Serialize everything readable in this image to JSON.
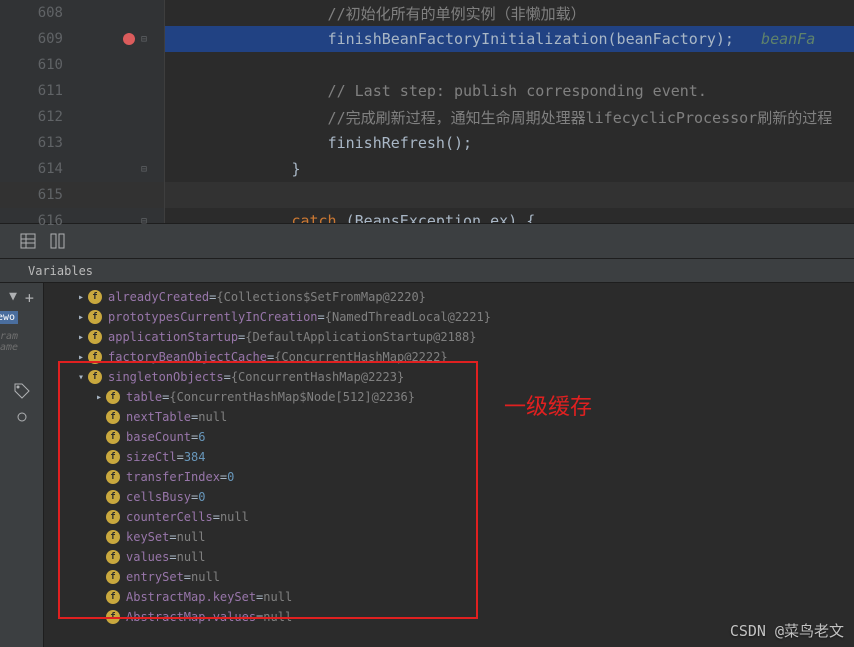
{
  "editor": {
    "lines": [
      {
        "num": "608",
        "kind": "cmt",
        "indent": "                  ",
        "text": "//初始化所有的单例实例（非懒加载）"
      },
      {
        "num": "609",
        "kind": "call",
        "indent": "                  ",
        "text": "finishBeanFactoryInitialization(beanFactory);",
        "hint": "   beanFa"
      },
      {
        "num": "610",
        "kind": "blank",
        "indent": "",
        "text": ""
      },
      {
        "num": "611",
        "kind": "cmt",
        "indent": "                  ",
        "text": "// Last step: publish corresponding event."
      },
      {
        "num": "612",
        "kind": "cmt",
        "indent": "                  ",
        "text": "//完成刷新过程，通知生命周期处理器lifecyclicProcessor刷新的过程"
      },
      {
        "num": "613",
        "kind": "call2",
        "indent": "                  ",
        "text": "finishRefresh();"
      },
      {
        "num": "614",
        "kind": "brace",
        "indent": "              ",
        "text": "}"
      },
      {
        "num": "615",
        "kind": "cursor",
        "indent": "",
        "text": ""
      },
      {
        "num": "616",
        "kind": "catch",
        "indent": "              ",
        "kw": "catch",
        "rest": " (BeansException ex) {"
      }
    ]
  },
  "variables_label": "Variables",
  "sidebar": {
    "sel_text": "ewo",
    "dim1": "ram",
    "dim2": "ame"
  },
  "tree": {
    "top": [
      {
        "name": "alreadyCreated",
        "val": "{Collections$SetFromMap@2220}"
      },
      {
        "name": "prototypesCurrentlyInCreation",
        "val": "{NamedThreadLocal@2221}"
      },
      {
        "name": "applicationStartup",
        "val": "{DefaultApplicationStartup@2188}"
      },
      {
        "name": "factoryBeanObjectCache",
        "val": "{ConcurrentHashMap@2222}"
      }
    ],
    "expanded": {
      "name": "singletonObjects",
      "val": "{ConcurrentHashMap@2223}"
    },
    "table": {
      "name": "table",
      "val": "{ConcurrentHashMap$Node[512]@2236}"
    },
    "fields": [
      {
        "name": "nextTable",
        "val": "null",
        "t": "null"
      },
      {
        "name": "baseCount",
        "val": "6",
        "t": "num"
      },
      {
        "name": "sizeCtl",
        "val": "384",
        "t": "num"
      },
      {
        "name": "transferIndex",
        "val": "0",
        "t": "num"
      },
      {
        "name": "cellsBusy",
        "val": "0",
        "t": "num"
      },
      {
        "name": "counterCells",
        "val": "null",
        "t": "null"
      },
      {
        "name": "keySet",
        "val": "null",
        "t": "null"
      },
      {
        "name": "values",
        "val": "null",
        "t": "null"
      },
      {
        "name": "entrySet",
        "val": "null",
        "t": "null"
      },
      {
        "name": "AbstractMap.keySet",
        "val": "null",
        "t": "null"
      },
      {
        "name": "AbstractMap.values",
        "val": "null",
        "t": "null"
      }
    ]
  },
  "annotation": "一级缓存",
  "watermark": "CSDN @菜鸟老文"
}
